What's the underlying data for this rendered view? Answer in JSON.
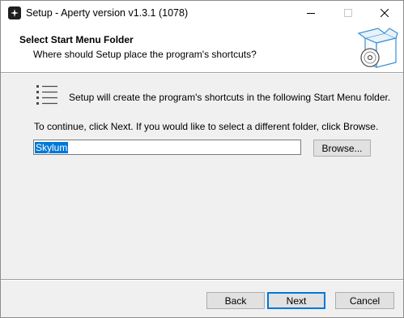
{
  "window": {
    "title": "Setup - Aperty version v1.3.1 (1078)"
  },
  "header": {
    "title": "Select Start Menu Folder",
    "subtitle": "Where should Setup place the program's shortcuts?"
  },
  "body": {
    "info_text": "Setup will create the program's shortcuts in the following Start Menu folder.",
    "continue_text": "To continue, click Next. If you would like to select a different folder, click Browse.",
    "folder_value": "Skylum",
    "browse_label": "Browse..."
  },
  "footer": {
    "back_label": "Back",
    "next_label": "Next",
    "cancel_label": "Cancel"
  },
  "icons": {
    "app": "app-icon",
    "minimize": "minimize-icon",
    "maximize": "maximize-icon",
    "close": "close-icon",
    "header_graphic": "setup-box-icon",
    "folder_list": "start-menu-list-icon"
  },
  "colors": {
    "accent": "#0078d7",
    "selection": "#0078d7",
    "button_face": "#e1e1e1",
    "window_bg": "#f0f0f0"
  }
}
